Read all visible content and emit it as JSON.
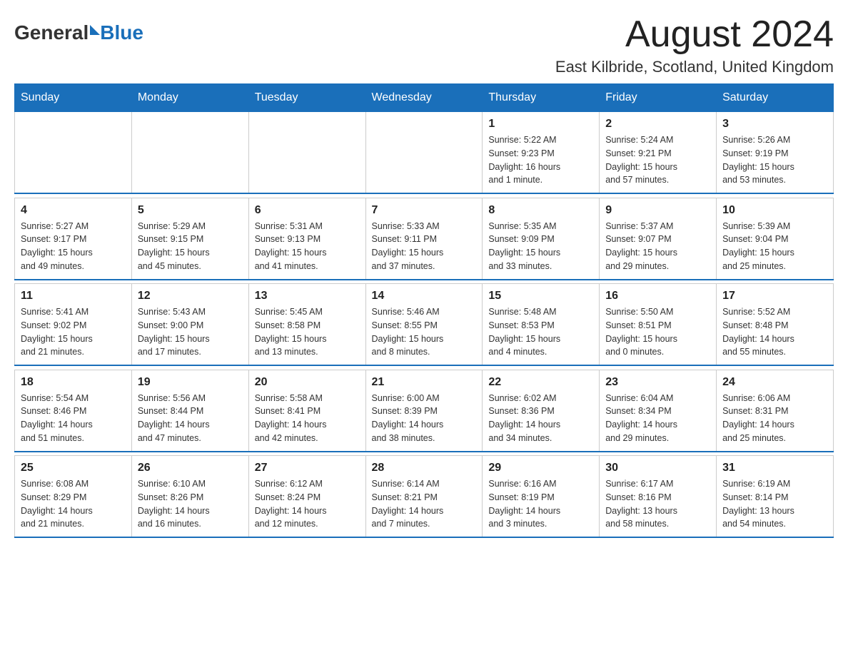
{
  "header": {
    "logo_general": "General",
    "logo_blue": "Blue",
    "month_title": "August 2024",
    "location": "East Kilbride, Scotland, United Kingdom"
  },
  "days_of_week": [
    "Sunday",
    "Monday",
    "Tuesday",
    "Wednesday",
    "Thursday",
    "Friday",
    "Saturday"
  ],
  "weeks": [
    {
      "days": [
        {
          "num": "",
          "info": ""
        },
        {
          "num": "",
          "info": ""
        },
        {
          "num": "",
          "info": ""
        },
        {
          "num": "",
          "info": ""
        },
        {
          "num": "1",
          "info": "Sunrise: 5:22 AM\nSunset: 9:23 PM\nDaylight: 16 hours\nand 1 minute."
        },
        {
          "num": "2",
          "info": "Sunrise: 5:24 AM\nSunset: 9:21 PM\nDaylight: 15 hours\nand 57 minutes."
        },
        {
          "num": "3",
          "info": "Sunrise: 5:26 AM\nSunset: 9:19 PM\nDaylight: 15 hours\nand 53 minutes."
        }
      ]
    },
    {
      "days": [
        {
          "num": "4",
          "info": "Sunrise: 5:27 AM\nSunset: 9:17 PM\nDaylight: 15 hours\nand 49 minutes."
        },
        {
          "num": "5",
          "info": "Sunrise: 5:29 AM\nSunset: 9:15 PM\nDaylight: 15 hours\nand 45 minutes."
        },
        {
          "num": "6",
          "info": "Sunrise: 5:31 AM\nSunset: 9:13 PM\nDaylight: 15 hours\nand 41 minutes."
        },
        {
          "num": "7",
          "info": "Sunrise: 5:33 AM\nSunset: 9:11 PM\nDaylight: 15 hours\nand 37 minutes."
        },
        {
          "num": "8",
          "info": "Sunrise: 5:35 AM\nSunset: 9:09 PM\nDaylight: 15 hours\nand 33 minutes."
        },
        {
          "num": "9",
          "info": "Sunrise: 5:37 AM\nSunset: 9:07 PM\nDaylight: 15 hours\nand 29 minutes."
        },
        {
          "num": "10",
          "info": "Sunrise: 5:39 AM\nSunset: 9:04 PM\nDaylight: 15 hours\nand 25 minutes."
        }
      ]
    },
    {
      "days": [
        {
          "num": "11",
          "info": "Sunrise: 5:41 AM\nSunset: 9:02 PM\nDaylight: 15 hours\nand 21 minutes."
        },
        {
          "num": "12",
          "info": "Sunrise: 5:43 AM\nSunset: 9:00 PM\nDaylight: 15 hours\nand 17 minutes."
        },
        {
          "num": "13",
          "info": "Sunrise: 5:45 AM\nSunset: 8:58 PM\nDaylight: 15 hours\nand 13 minutes."
        },
        {
          "num": "14",
          "info": "Sunrise: 5:46 AM\nSunset: 8:55 PM\nDaylight: 15 hours\nand 8 minutes."
        },
        {
          "num": "15",
          "info": "Sunrise: 5:48 AM\nSunset: 8:53 PM\nDaylight: 15 hours\nand 4 minutes."
        },
        {
          "num": "16",
          "info": "Sunrise: 5:50 AM\nSunset: 8:51 PM\nDaylight: 15 hours\nand 0 minutes."
        },
        {
          "num": "17",
          "info": "Sunrise: 5:52 AM\nSunset: 8:48 PM\nDaylight: 14 hours\nand 55 minutes."
        }
      ]
    },
    {
      "days": [
        {
          "num": "18",
          "info": "Sunrise: 5:54 AM\nSunset: 8:46 PM\nDaylight: 14 hours\nand 51 minutes."
        },
        {
          "num": "19",
          "info": "Sunrise: 5:56 AM\nSunset: 8:44 PM\nDaylight: 14 hours\nand 47 minutes."
        },
        {
          "num": "20",
          "info": "Sunrise: 5:58 AM\nSunset: 8:41 PM\nDaylight: 14 hours\nand 42 minutes."
        },
        {
          "num": "21",
          "info": "Sunrise: 6:00 AM\nSunset: 8:39 PM\nDaylight: 14 hours\nand 38 minutes."
        },
        {
          "num": "22",
          "info": "Sunrise: 6:02 AM\nSunset: 8:36 PM\nDaylight: 14 hours\nand 34 minutes."
        },
        {
          "num": "23",
          "info": "Sunrise: 6:04 AM\nSunset: 8:34 PM\nDaylight: 14 hours\nand 29 minutes."
        },
        {
          "num": "24",
          "info": "Sunrise: 6:06 AM\nSunset: 8:31 PM\nDaylight: 14 hours\nand 25 minutes."
        }
      ]
    },
    {
      "days": [
        {
          "num": "25",
          "info": "Sunrise: 6:08 AM\nSunset: 8:29 PM\nDaylight: 14 hours\nand 21 minutes."
        },
        {
          "num": "26",
          "info": "Sunrise: 6:10 AM\nSunset: 8:26 PM\nDaylight: 14 hours\nand 16 minutes."
        },
        {
          "num": "27",
          "info": "Sunrise: 6:12 AM\nSunset: 8:24 PM\nDaylight: 14 hours\nand 12 minutes."
        },
        {
          "num": "28",
          "info": "Sunrise: 6:14 AM\nSunset: 8:21 PM\nDaylight: 14 hours\nand 7 minutes."
        },
        {
          "num": "29",
          "info": "Sunrise: 6:16 AM\nSunset: 8:19 PM\nDaylight: 14 hours\nand 3 minutes."
        },
        {
          "num": "30",
          "info": "Sunrise: 6:17 AM\nSunset: 8:16 PM\nDaylight: 13 hours\nand 58 minutes."
        },
        {
          "num": "31",
          "info": "Sunrise: 6:19 AM\nSunset: 8:14 PM\nDaylight: 13 hours\nand 54 minutes."
        }
      ]
    }
  ]
}
